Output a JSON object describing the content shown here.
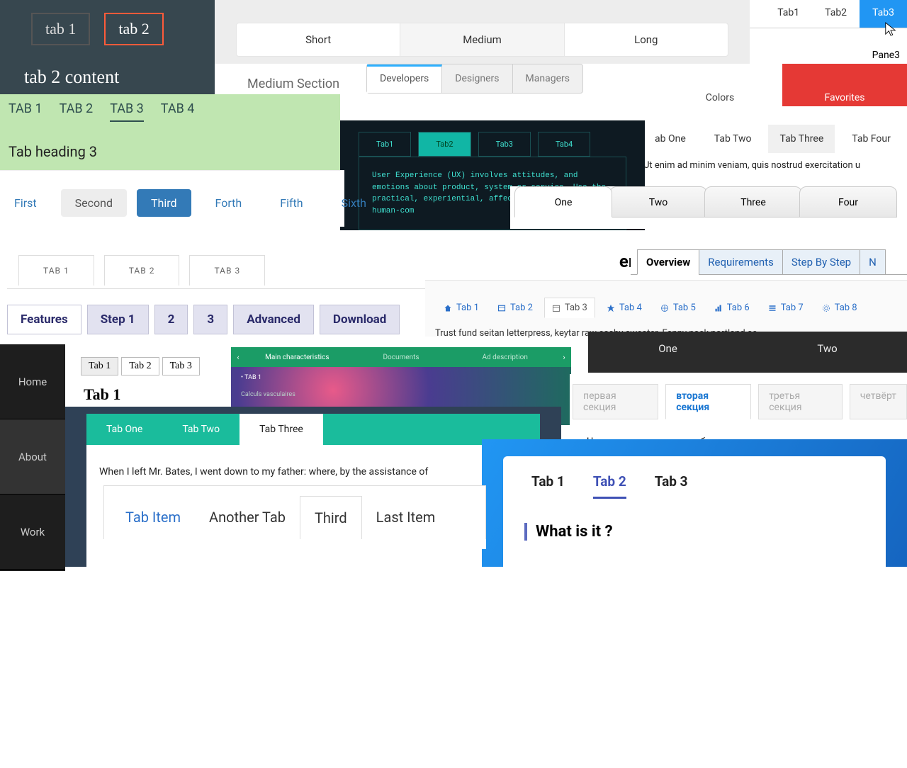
{
  "p1": {
    "tabs": [
      "tab 1",
      "tab 2"
    ],
    "content": "tab 2 content"
  },
  "p2": {
    "tabs": [
      "Tab1",
      "Tab2",
      "Tab3"
    ],
    "pane": "Pane3"
  },
  "p3": {
    "tabs": [
      "Short",
      "Medium",
      "Long"
    ]
  },
  "p4": {
    "header": "Medium Section",
    "mini": [
      "Developers",
      "Designers",
      "Managers"
    ]
  },
  "p5": {
    "tabs": [
      "Colors",
      "Favorites"
    ]
  },
  "p6": {
    "tabs": [
      "TAB 1",
      "TAB 2",
      "TAB 3",
      "TAB 4"
    ],
    "heading": "Tab heading 3"
  },
  "p7": {
    "tabs": [
      "First",
      "Second",
      "Third",
      "Forth",
      "Fifth",
      "Sixth"
    ]
  },
  "p8": {
    "tabs": [
      "Tab1",
      "Tab2",
      "Tab3",
      "Tab4"
    ],
    "body": "User Experience (UX) involves attitudes, and emotions about product, system or service. Use the practical, experiential, affec valuable aspects of human-com"
  },
  "p9": {
    "tabs": [
      "ab One",
      "Tab Two",
      "Tab Three",
      "Tab Four"
    ],
    "body": "Ut enim ad minim veniam, quis nostrud exercitation u"
  },
  "p10": {
    "tabs": [
      "One",
      "Two",
      "Three",
      "Four"
    ]
  },
  "p11": {
    "tabs": [
      "TAB 1",
      "TAB 2",
      "TAB 3"
    ]
  },
  "p12": {
    "heading": "em ipsum",
    "tabs": [
      "Overview",
      "Requirements",
      "Step By Step",
      "N"
    ]
  },
  "p13": {
    "tabs": [
      "Tab 1",
      "Tab 2",
      "Tab 3",
      "Tab 4",
      "Tab 5",
      "Tab 6",
      "Tab 7",
      "Tab 8"
    ],
    "body": "Trust fund seitan letterpress, keytar raw cosby sweater. Fanny pack portland se"
  },
  "p14": {
    "tabs": [
      "Features",
      "Step 1",
      "2",
      "3",
      "Advanced",
      "Download"
    ]
  },
  "p15": {
    "items": [
      "Home",
      "About",
      "Work"
    ]
  },
  "p16": {
    "tabs": [
      "Tab 1",
      "Tab 2",
      "Tab 3"
    ],
    "heading": "Tab 1"
  },
  "p17": {
    "tabs": [
      "Main characteristics",
      "Documents",
      "Ad description"
    ],
    "sub1": "• TAB 1",
    "sub2": "Calculs vasculaires"
  },
  "p18": {
    "tabs": [
      "One",
      "Two"
    ]
  },
  "p19": {
    "tabs": [
      "первая секция",
      "вторая секция",
      "третья секция",
      "четвёрт"
    ],
    "body": "Нормаль к поверхности, общеизвестно, концентрирует анормал"
  },
  "p20": {
    "tabs": [
      "Tab One",
      "Tab Two",
      "Tab Three"
    ],
    "body": "When I left Mr. Bates, I went down to my father: where, by the assistance of"
  },
  "p21": {
    "tabs": [
      "Tab Item",
      "Another Tab",
      "Third",
      "Last Item"
    ]
  },
  "p22": {
    "tabs": [
      "Tab 1",
      "Tab 2",
      "Tab 3"
    ],
    "heading": "What is it ?"
  }
}
